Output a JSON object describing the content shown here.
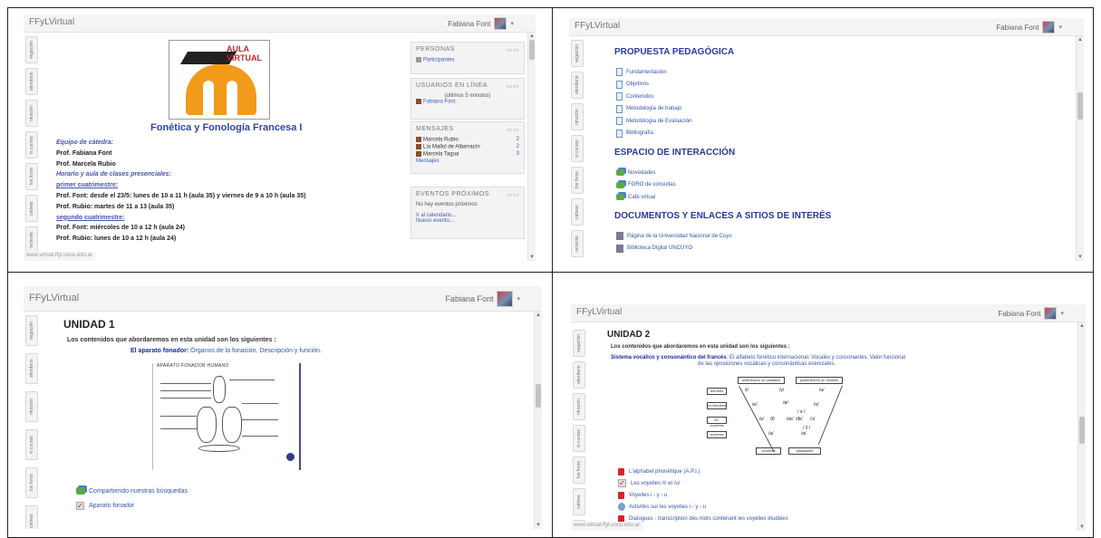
{
  "brand": "FFyLVirtual",
  "user": "Fabiana Font",
  "side_tabs": [
    "vegación",
    "alendario",
    "ntración",
    "is cursos",
    "los foros",
    "cativas",
    "recienta"
  ],
  "status_url": "www.virtual.ffyl.uncu.edu.ar",
  "panel1": {
    "logo_line1": "AULA",
    "logo_line2": "VIRTUAL",
    "course_title": "Fonética y Fonología Francesa I",
    "lines": [
      {
        "style": "i",
        "text": "Equipo de cátedra:"
      },
      {
        "style": "b",
        "text": "Prof. Fabiana Font"
      },
      {
        "style": "b",
        "text": "Prof. Marcela Rubio"
      },
      {
        "style": "i",
        "text": "Horario y aula de clases presenciales:"
      },
      {
        "style": "u",
        "text": "primer cuatrimestre:"
      },
      {
        "style": "b",
        "text": "Prof. Font: desde el 23/5: lunes de 10 a 11 h (aula 35) y viernes de 9 a 10 h (aula 35)"
      },
      {
        "style": "b",
        "text": "Prof. Rubio: martes de 11 a 13 (aula 35)"
      },
      {
        "style": "u",
        "text": "segundo cuatrimestre:"
      },
      {
        "style": "b",
        "text": "Prof. Font: miércoles de 10 a 12 h (aula 24)"
      },
      {
        "style": "b",
        "text": "Prof. Rubio: lunes de 10 a 12 h (aula 24)"
      }
    ],
    "blocks": {
      "personas": {
        "title": "PERSONAS",
        "link": "Participantes"
      },
      "online": {
        "title": "USUARIOS EN LÍNEA",
        "note": "(últimos 5 minutos)",
        "user": "Fabiana Font"
      },
      "messages": {
        "title": "MENSAJES",
        "rows": [
          {
            "name": "Marcela Rubio",
            "count": "2"
          },
          {
            "name": "Lía Mallol de Albarracín",
            "count": "2"
          },
          {
            "name": "Marcela Tagua",
            "count": "3"
          }
        ],
        "link": "Mensajes"
      },
      "events": {
        "title": "EVENTOS PRÓXIMOS",
        "none": "No hay eventos próximos",
        "cal": "Ir al calendario...",
        "new": "Nuevo evento..."
      }
    }
  },
  "panel2": {
    "sec1": "PROPUESTA PEDAGÓGICA",
    "sec1_items": [
      "Fundamentación",
      "Objetivos",
      "Contenidos",
      "Metodología de trabajo",
      "Metodología de Evaluación",
      "Bibliografía"
    ],
    "sec2": "ESPACIO DE INTERACCIÓN",
    "sec2_items": [
      "Novedades",
      "FORO de consultas",
      "Café virtual"
    ],
    "sec3": "DOCUMENTOS Y ENLACES A SITIOS DE INTERÉS",
    "sec3_items": [
      "Página de la Universidad Nacional de Cuyo",
      "Biblioteca Digital UNCUYO"
    ]
  },
  "panel3": {
    "title": "UNIDAD 1",
    "intro": "Los contenidos que abordaremos en esta unidad son los siguientes  :",
    "topic_bold": "El aparato fonador:",
    "topic_rest": " Órganos de la fonación. Descripción y función.",
    "figure_caption": "APARATO FONADOR HUMANO",
    "links": [
      "Compartiendo nuestras búsquedas",
      "Aparato fonador"
    ]
  },
  "panel4": {
    "title": "UNIDAD 2",
    "intro": "Los contenidos que abordaremos en esta unidad son los siguientes  :",
    "topic_bold": "Sistema vocálico y consonántico del francés",
    "topic_rest": ". El alfabeto fonético internacional. Vocales y consonantes. Valor funcional",
    "topic_line2": "de las oposiciones vocálicas y consonánticas esenciales.",
    "diagram": {
      "top_left": "antérieures ou palatales",
      "top_right": "postérieures ou vélaires",
      "rows": [
        "fermées",
        "mi-fermées",
        "mi-ouvertes",
        "ouvertes"
      ],
      "bottom_left": "ouvertes",
      "bottom_right": "labialisées"
    },
    "links": [
      "L'alphabet phonétique (A.P.I.)",
      "Les voyelles /i/ et /u/",
      "Voyelles i - y - u",
      "Activités sur les voyelles i - y - u",
      "Dialogues - transcription des mots contenant les voyelles étudiées"
    ]
  }
}
